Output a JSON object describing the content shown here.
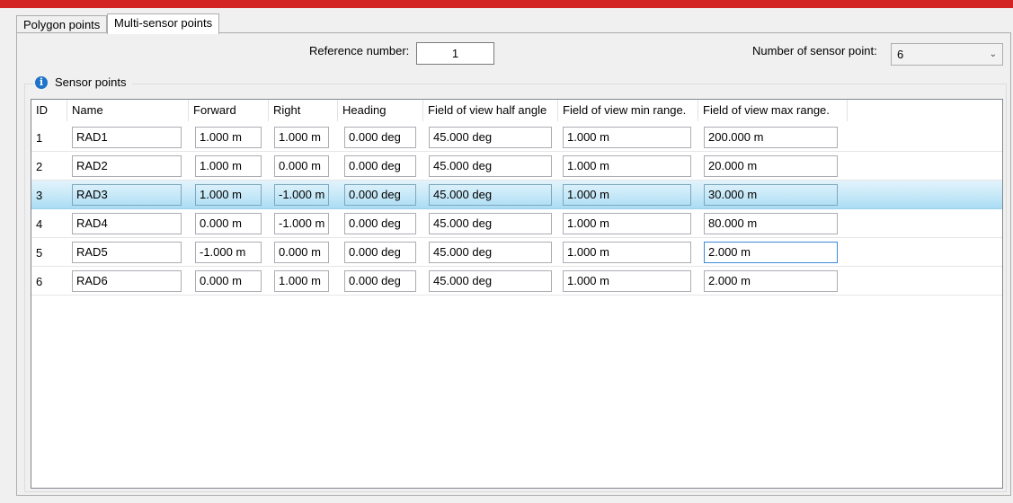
{
  "tabs": [
    {
      "label": "Polygon points",
      "active": false
    },
    {
      "label": "Multi-sensor points",
      "active": true
    }
  ],
  "reference": {
    "label": "Reference number:",
    "value": "1"
  },
  "sensor_count": {
    "label": "Number of sensor point:",
    "value": "6"
  },
  "group": {
    "title": "Sensor points",
    "icon": "info-icon"
  },
  "table": {
    "columns": [
      "ID",
      "Name",
      "Forward",
      "Right",
      "Heading",
      "Field of view half angle",
      "Field of view min range.",
      "Field of view max range."
    ],
    "rows": [
      {
        "id": "1",
        "name": "RAD1",
        "forward": "1.000 m",
        "right": "1.000 m",
        "heading": "0.000 deg",
        "half_angle": "45.000 deg",
        "min_range": "1.000 m",
        "max_range": "200.000 m"
      },
      {
        "id": "2",
        "name": "RAD2",
        "forward": "1.000 m",
        "right": "0.000 m",
        "heading": "0.000 deg",
        "half_angle": "45.000 deg",
        "min_range": "1.000 m",
        "max_range": "20.000 m"
      },
      {
        "id": "3",
        "name": "RAD3",
        "forward": "1.000 m",
        "right": "-1.000 m",
        "heading": "0.000 deg",
        "half_angle": "45.000 deg",
        "min_range": "1.000 m",
        "max_range": "30.000 m"
      },
      {
        "id": "4",
        "name": "RAD4",
        "forward": "0.000 m",
        "right": "-1.000 m",
        "heading": "0.000 deg",
        "half_angle": "45.000 deg",
        "min_range": "1.000 m",
        "max_range": "80.000 m"
      },
      {
        "id": "5",
        "name": "RAD5",
        "forward": "-1.000 m",
        "right": "0.000 m",
        "heading": "0.000 deg",
        "half_angle": "45.000 deg",
        "min_range": "1.000 m",
        "max_range": "2.000 m"
      },
      {
        "id": "6",
        "name": "RAD6",
        "forward": "0.000 m",
        "right": "1.000 m",
        "heading": "0.000 deg",
        "half_angle": "45.000 deg",
        "min_range": "1.000 m",
        "max_range": "2.000 m"
      }
    ],
    "selected_row": 2
  },
  "colors": {
    "brand_bar": "#d42323",
    "selection": "#c6e8f8",
    "info_icon": "#1e74c9"
  }
}
